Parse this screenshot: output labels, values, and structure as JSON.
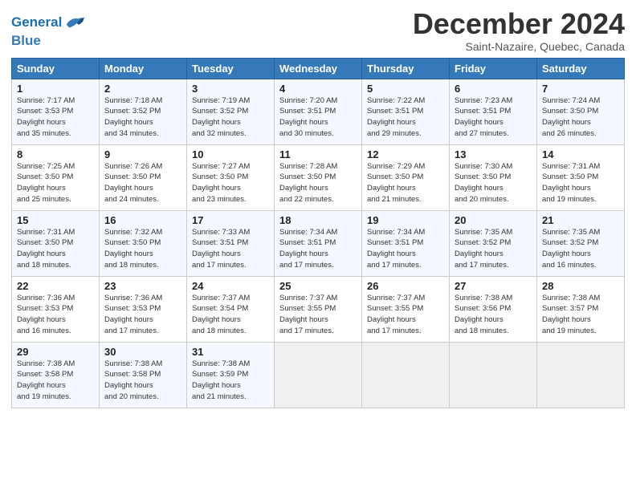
{
  "header": {
    "logo_line1": "General",
    "logo_line2": "Blue",
    "month_title": "December 2024",
    "location": "Saint-Nazaire, Quebec, Canada"
  },
  "weekdays": [
    "Sunday",
    "Monday",
    "Tuesday",
    "Wednesday",
    "Thursday",
    "Friday",
    "Saturday"
  ],
  "weeks": [
    [
      {
        "day": "1",
        "sunrise": "7:17 AM",
        "sunset": "3:53 PM",
        "daylight": "8 hours and 35 minutes."
      },
      {
        "day": "2",
        "sunrise": "7:18 AM",
        "sunset": "3:52 PM",
        "daylight": "8 hours and 34 minutes."
      },
      {
        "day": "3",
        "sunrise": "7:19 AM",
        "sunset": "3:52 PM",
        "daylight": "8 hours and 32 minutes."
      },
      {
        "day": "4",
        "sunrise": "7:20 AM",
        "sunset": "3:51 PM",
        "daylight": "8 hours and 30 minutes."
      },
      {
        "day": "5",
        "sunrise": "7:22 AM",
        "sunset": "3:51 PM",
        "daylight": "8 hours and 29 minutes."
      },
      {
        "day": "6",
        "sunrise": "7:23 AM",
        "sunset": "3:51 PM",
        "daylight": "8 hours and 27 minutes."
      },
      {
        "day": "7",
        "sunrise": "7:24 AM",
        "sunset": "3:50 PM",
        "daylight": "8 hours and 26 minutes."
      }
    ],
    [
      {
        "day": "8",
        "sunrise": "7:25 AM",
        "sunset": "3:50 PM",
        "daylight": "8 hours and 25 minutes."
      },
      {
        "day": "9",
        "sunrise": "7:26 AM",
        "sunset": "3:50 PM",
        "daylight": "8 hours and 24 minutes."
      },
      {
        "day": "10",
        "sunrise": "7:27 AM",
        "sunset": "3:50 PM",
        "daylight": "8 hours and 23 minutes."
      },
      {
        "day": "11",
        "sunrise": "7:28 AM",
        "sunset": "3:50 PM",
        "daylight": "8 hours and 22 minutes."
      },
      {
        "day": "12",
        "sunrise": "7:29 AM",
        "sunset": "3:50 PM",
        "daylight": "8 hours and 21 minutes."
      },
      {
        "day": "13",
        "sunrise": "7:30 AM",
        "sunset": "3:50 PM",
        "daylight": "8 hours and 20 minutes."
      },
      {
        "day": "14",
        "sunrise": "7:31 AM",
        "sunset": "3:50 PM",
        "daylight": "8 hours and 19 minutes."
      }
    ],
    [
      {
        "day": "15",
        "sunrise": "7:31 AM",
        "sunset": "3:50 PM",
        "daylight": "8 hours and 18 minutes."
      },
      {
        "day": "16",
        "sunrise": "7:32 AM",
        "sunset": "3:50 PM",
        "daylight": "8 hours and 18 minutes."
      },
      {
        "day": "17",
        "sunrise": "7:33 AM",
        "sunset": "3:51 PM",
        "daylight": "8 hours and 17 minutes."
      },
      {
        "day": "18",
        "sunrise": "7:34 AM",
        "sunset": "3:51 PM",
        "daylight": "8 hours and 17 minutes."
      },
      {
        "day": "19",
        "sunrise": "7:34 AM",
        "sunset": "3:51 PM",
        "daylight": "8 hours and 17 minutes."
      },
      {
        "day": "20",
        "sunrise": "7:35 AM",
        "sunset": "3:52 PM",
        "daylight": "8 hours and 17 minutes."
      },
      {
        "day": "21",
        "sunrise": "7:35 AM",
        "sunset": "3:52 PM",
        "daylight": "8 hours and 16 minutes."
      }
    ],
    [
      {
        "day": "22",
        "sunrise": "7:36 AM",
        "sunset": "3:53 PM",
        "daylight": "8 hours and 16 minutes."
      },
      {
        "day": "23",
        "sunrise": "7:36 AM",
        "sunset": "3:53 PM",
        "daylight": "8 hours and 17 minutes."
      },
      {
        "day": "24",
        "sunrise": "7:37 AM",
        "sunset": "3:54 PM",
        "daylight": "8 hours and 18 minutes."
      },
      {
        "day": "25",
        "sunrise": "7:37 AM",
        "sunset": "3:55 PM",
        "daylight": "8 hours and 17 minutes."
      },
      {
        "day": "26",
        "sunrise": "7:37 AM",
        "sunset": "3:55 PM",
        "daylight": "8 hours and 17 minutes."
      },
      {
        "day": "27",
        "sunrise": "7:38 AM",
        "sunset": "3:56 PM",
        "daylight": "8 hours and 18 minutes."
      },
      {
        "day": "28",
        "sunrise": "7:38 AM",
        "sunset": "3:57 PM",
        "daylight": "8 hours and 19 minutes."
      }
    ],
    [
      {
        "day": "29",
        "sunrise": "7:38 AM",
        "sunset": "3:58 PM",
        "daylight": "8 hours and 19 minutes."
      },
      {
        "day": "30",
        "sunrise": "7:38 AM",
        "sunset": "3:58 PM",
        "daylight": "8 hours and 20 minutes."
      },
      {
        "day": "31",
        "sunrise": "7:38 AM",
        "sunset": "3:59 PM",
        "daylight": "8 hours and 21 minutes."
      },
      null,
      null,
      null,
      null
    ]
  ]
}
